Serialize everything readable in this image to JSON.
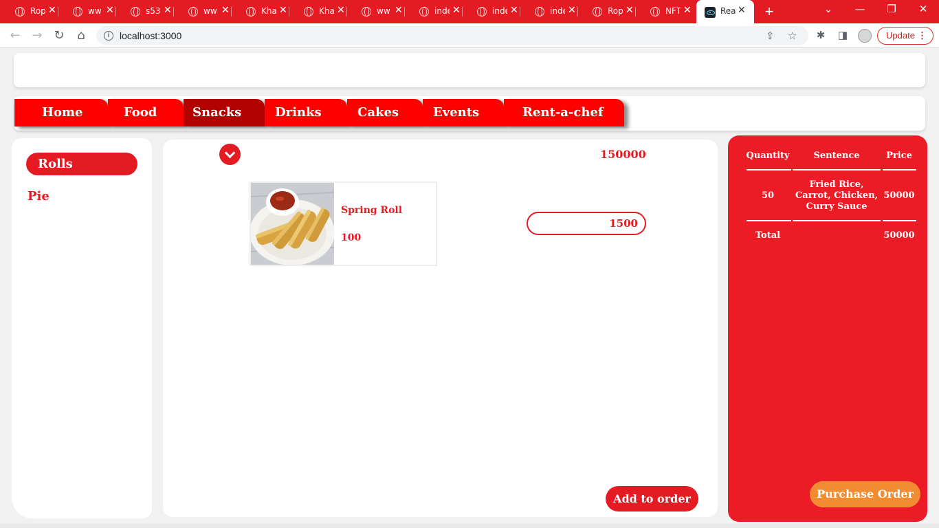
{
  "browser": {
    "tabs": [
      {
        "label": "Rop"
      },
      {
        "label": "ww"
      },
      {
        "label": "s53"
      },
      {
        "label": "ww"
      },
      {
        "label": "Kha"
      },
      {
        "label": "Kha"
      },
      {
        "label": "ww"
      },
      {
        "label": "inde"
      },
      {
        "label": "inde"
      },
      {
        "label": "inde"
      },
      {
        "label": "Rop"
      },
      {
        "label": "NFT"
      }
    ],
    "active_tab": {
      "label": "Rea"
    },
    "new_tab_symbol": "+",
    "url": "localhost:3000",
    "update_label": "Update",
    "colors": {
      "tabstrip": "#e51b23"
    }
  },
  "nav": {
    "items": [
      {
        "label": "Home"
      },
      {
        "label": "Food"
      },
      {
        "label": "Snacks"
      },
      {
        "label": "Drinks"
      },
      {
        "label": "Cakes"
      },
      {
        "label": "Events"
      },
      {
        "label": "Rent-a-chef"
      }
    ],
    "active": "Snacks"
  },
  "categories": {
    "items": [
      {
        "label": "Rolls"
      },
      {
        "label": "Pie"
      }
    ],
    "active": "Rolls"
  },
  "main": {
    "grand_total": "150000",
    "product": {
      "name": "Spring Roll",
      "price": "100"
    },
    "quantity_value": "1500",
    "add_button": "Add to order"
  },
  "order": {
    "headers": {
      "quantity": "Quantity",
      "sentence": "Sentence",
      "price": "Price"
    },
    "rows": [
      {
        "quantity": "50",
        "sentence": [
          "Fried Rice,",
          "Carrot, Chicken,",
          "Curry Sauce"
        ],
        "price": "50000"
      }
    ],
    "total_label": "Total",
    "total_value": "50000",
    "purchase_button": "Purchase Order"
  },
  "colors": {
    "brand_red": "#e41b23",
    "menu_red": "#ff0000",
    "active_menu": "#b30000",
    "purchase_orange": "#f28c33"
  }
}
